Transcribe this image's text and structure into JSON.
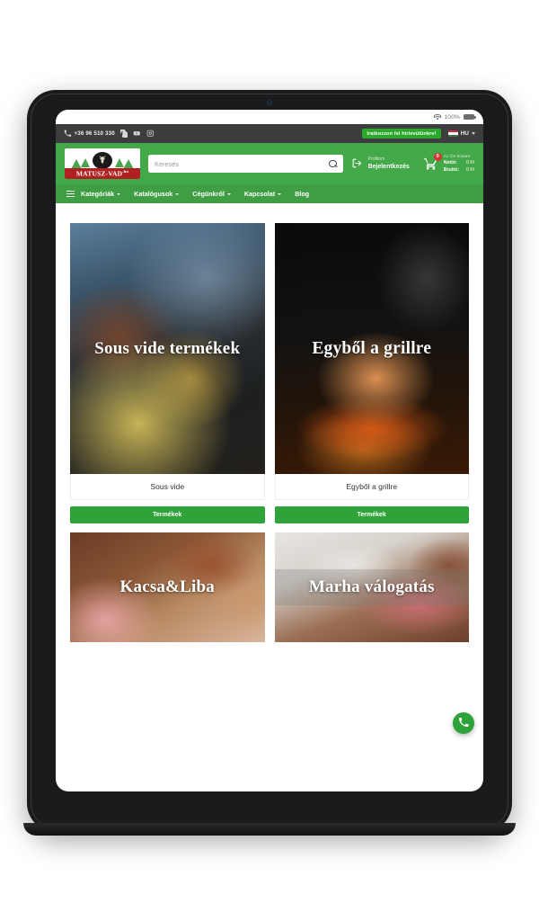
{
  "device": {
    "status_bar": {
      "battery_text": "100%",
      "wifi_icon": "wifi-icon",
      "battery_icon": "battery-icon"
    }
  },
  "topbar": {
    "phone": "+36 96 510 330",
    "phone_icon": "phone-icon",
    "social": [
      {
        "name": "facebook-icon",
        "glyph": "f"
      },
      {
        "name": "youtube-icon",
        "glyph": "▶"
      },
      {
        "name": "instagram-icon",
        "glyph": "▢"
      }
    ],
    "newsletter_badge": "Iratkozzon fel hírlevülünkre!",
    "language": "HU",
    "language_flag": "hungary-flag-icon"
  },
  "header": {
    "logo_name": "MATUSZ-VAD",
    "logo_suffix": ".hu",
    "search": {
      "placeholder": "Keresés",
      "value": "",
      "icon": "search-icon"
    },
    "login": {
      "eyebrow": "Profilom",
      "label": "Bejelentkezés",
      "icon": "login-icon"
    },
    "cart": {
      "icon": "cart-icon",
      "badge": "0",
      "title": "Az Ön kosara",
      "net_label": "Nettó:",
      "net_value": "0 Ft",
      "gross_label": "Bruttó:",
      "gross_value": "0 Ft"
    }
  },
  "nav": {
    "menu_icon": "hamburger-icon",
    "items": [
      {
        "label": "Kategóriák",
        "has_dropdown": true
      },
      {
        "label": "Katalógusok",
        "has_dropdown": true
      },
      {
        "label": "Cégünkről",
        "has_dropdown": true
      },
      {
        "label": "Kapcsolat",
        "has_dropdown": true
      },
      {
        "label": "Blog",
        "has_dropdown": false
      }
    ]
  },
  "cards": [
    {
      "overlay_title": "Sous vide termékek",
      "label": "Sous vide",
      "button": "Termékek"
    },
    {
      "overlay_title": "Egyből a grillre",
      "label": "Egyből a grillre",
      "button": "Termékek"
    },
    {
      "overlay_title": "Kacsa&Liba",
      "label": "",
      "button": ""
    },
    {
      "overlay_title": "Marha válogatás",
      "label": "",
      "button": ""
    }
  ],
  "fab": {
    "name": "call-fab",
    "icon": "phone-icon"
  },
  "colors": {
    "brand_green": "#43a847",
    "nav_green": "#3f9e43",
    "button_green": "#2fa33a",
    "badge_green": "#2aa82a",
    "topbar_dark": "#3d3d3f",
    "cart_badge_red": "#d83434",
    "logo_red": "#b02020"
  }
}
